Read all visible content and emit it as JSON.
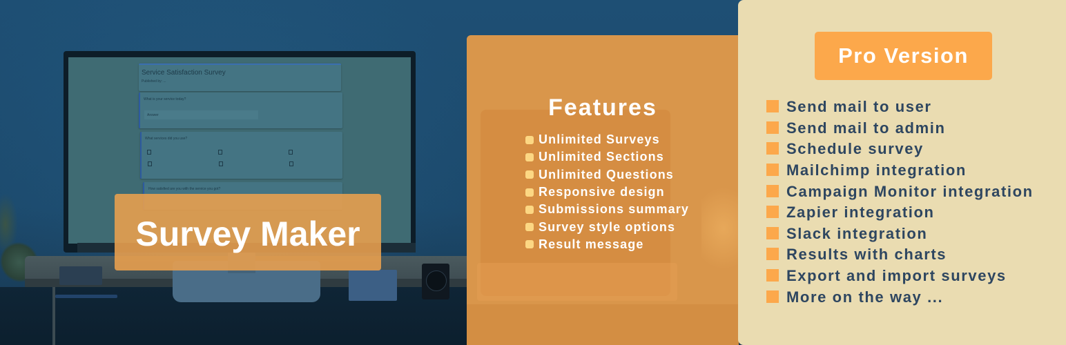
{
  "hero": {
    "product_name": "Survey Maker"
  },
  "monitor_form": {
    "title": "Service Satisfaction Survey",
    "subtitle": "Published by: ...",
    "question_1": "What is your service today?",
    "answer_placeholder": "Answer",
    "question_2": "What services did you use?",
    "question_3": "How satisfied are you with the service you got?"
  },
  "features": {
    "title": "Features",
    "items": [
      "Unlimited Surveys",
      "Unlimited Sections",
      "Unlimited Questions",
      "Responsive design",
      "Submissions summary",
      "Survey style options",
      "Result message"
    ]
  },
  "pro": {
    "button_label": "Pro Version",
    "items": [
      "Send mail to user",
      "Send mail to admin",
      "Schedule survey",
      "Mailchimp integration",
      "Campaign Monitor integration",
      "Zapier integration",
      "Slack integration",
      "Results with charts",
      "Export and import surveys",
      "More on the way ..."
    ]
  },
  "colors": {
    "accent_orange": "#fca84b",
    "features_panel": "#d9964b",
    "pro_panel": "#eadcb1",
    "pro_text": "#2e4660",
    "feature_bullet": "#fcd783",
    "background_blue": "#1e4f74"
  }
}
